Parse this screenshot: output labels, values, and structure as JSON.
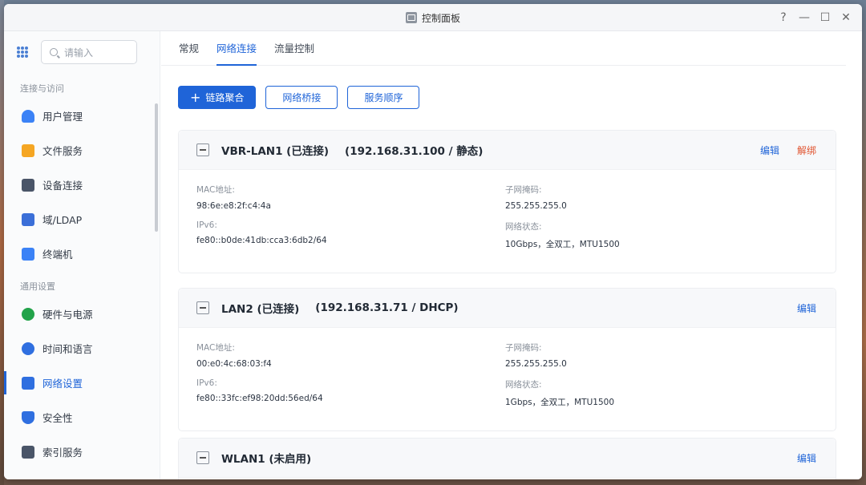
{
  "window": {
    "title": "控制面板",
    "controls": {
      "help": "?",
      "minimize": "—",
      "maximize": "☐",
      "close": "✕"
    }
  },
  "sidebar": {
    "search_placeholder": "请输入",
    "sections": [
      {
        "label": "连接与访问",
        "items": [
          {
            "label": "用户管理",
            "icon": "user-icon",
            "color": "#3b82f6"
          },
          {
            "label": "文件服务",
            "icon": "folder-icon",
            "color": "#f5a623"
          },
          {
            "label": "设备连接",
            "icon": "device-icon",
            "color": "#4a5568"
          },
          {
            "label": "域/LDAP",
            "icon": "domain-icon",
            "color": "#3b6fd8"
          },
          {
            "label": "终端机",
            "icon": "terminal-icon",
            "color": "#3b82f6"
          }
        ]
      },
      {
        "label": "通用设置",
        "items": [
          {
            "label": "硬件与电源",
            "icon": "battery-icon",
            "color": "#22a34a"
          },
          {
            "label": "时间和语言",
            "icon": "globe-icon",
            "color": "#2f6fe0"
          },
          {
            "label": "网络设置",
            "icon": "network-icon",
            "color": "#2f6fe0",
            "active": true
          },
          {
            "label": "安全性",
            "icon": "shield-icon",
            "color": "#2f6fe0"
          },
          {
            "label": "索引服务",
            "icon": "index-icon",
            "color": "#4a5568"
          }
        ]
      }
    ]
  },
  "tabs": [
    {
      "label": "常规"
    },
    {
      "label": "网络连接",
      "active": true
    },
    {
      "label": "流量控制"
    }
  ],
  "actions": {
    "link_aggregation": "链路聚合",
    "network_bridge": "网络桥接",
    "service_order": "服务顺序"
  },
  "interfaces": [
    {
      "name": "VBR-LAN1 (已连接)",
      "address": "(192.168.31.100 / 静态)",
      "edit": "编辑",
      "unbind": "解绑",
      "mac_label": "MAC地址:",
      "mac": "98:6e:e8:2f:c4:4a",
      "ipv6_label": "IPv6:",
      "ipv6": "fe80::b0de:41db:cca3:6db2/64",
      "subnet_label": "子网掩码:",
      "subnet": "255.255.255.0",
      "status_label": "网络状态:",
      "status": "10Gbps，全双工，MTU1500"
    },
    {
      "name": "LAN2 (已连接)",
      "address": "(192.168.31.71 / DHCP)",
      "edit": "编辑",
      "mac_label": "MAC地址:",
      "mac": "00:e0:4c:68:03:f4",
      "ipv6_label": "IPv6:",
      "ipv6": "fe80::33fc:ef98:20dd:56ed/64",
      "subnet_label": "子网掩码:",
      "subnet": "255.255.255.0",
      "status_label": "网络状态:",
      "status": "1Gbps，全双工，MTU1500"
    },
    {
      "name": "WLAN1 (未启用)",
      "edit": "编辑"
    }
  ]
}
